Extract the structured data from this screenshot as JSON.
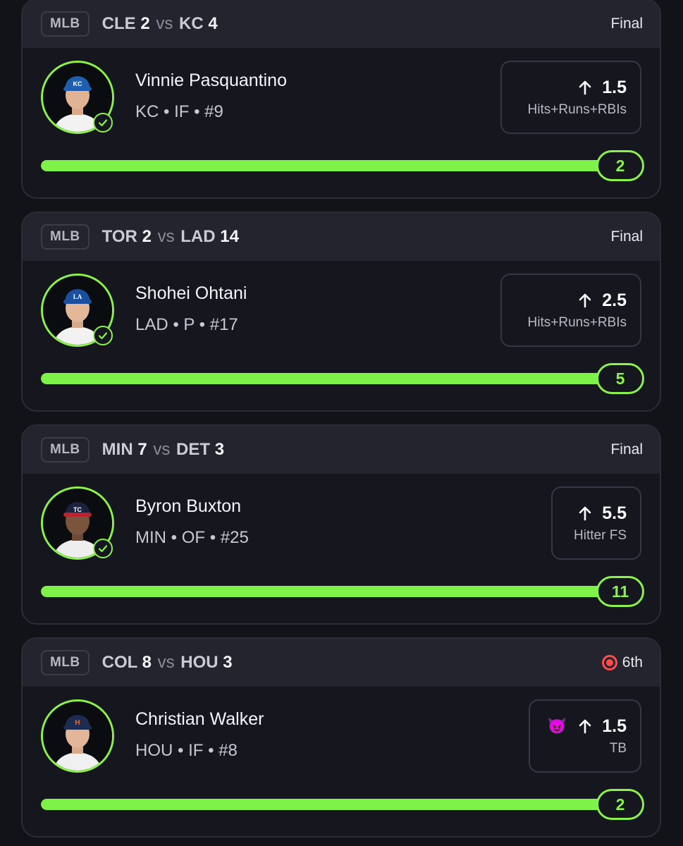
{
  "cards": [
    {
      "league": "MLB",
      "away_team": "CLE",
      "away_score": "2",
      "vs": "vs",
      "home_team": "KC",
      "home_score": "4",
      "status": "Final",
      "player_name": "Vinnie Pasquantino",
      "player_meta": "KC • IF • #9",
      "pick_line": "1.5",
      "pick_stat": "Hits+Runs+RBIs",
      "result": "2",
      "progress": 1.0,
      "cap_color": "#1f5fb0",
      "jersey_color": "#f2f2f2"
    },
    {
      "league": "MLB",
      "away_team": "TOR",
      "away_score": "2",
      "vs": "vs",
      "home_team": "LAD",
      "home_score": "14",
      "status": "Final",
      "player_name": "Shohei Ohtani",
      "player_meta": "LAD • P • #17",
      "pick_line": "2.5",
      "pick_stat": "Hits+Runs+RBIs",
      "result": "5",
      "progress": 1.0,
      "cap_color": "#1a4fa0",
      "jersey_color": "#f2f2f2"
    },
    {
      "league": "MLB",
      "away_team": "MIN",
      "away_score": "7",
      "vs": "vs",
      "home_team": "DET",
      "home_score": "3",
      "status": "Final",
      "player_name": "Byron Buxton",
      "player_meta": "MIN • OF • #25",
      "pick_line": "5.5",
      "pick_stat": "Hitter FS",
      "result": "11",
      "progress": 1.0,
      "cap_color": "#1a2240",
      "jersey_color": "#eeeeee"
    },
    {
      "league": "MLB",
      "away_team": "COL",
      "away_score": "8",
      "vs": "vs",
      "home_team": "HOU",
      "home_score": "3",
      "status": "6th",
      "player_name": "Christian Walker",
      "player_meta": "HOU • IF • #8",
      "pick_line": "1.5",
      "pick_stat": "TB",
      "pick_emoji": "😈",
      "result": "2",
      "progress": 1.0,
      "cap_color": "#1d2d52",
      "jersey_color": "#f0f0f0"
    }
  ],
  "colors": {
    "accent_green": "#8af24a",
    "live_red": "#ff4b4b"
  },
  "icons": {
    "up_arrow": "arrow-up-icon",
    "check": "check-circle-icon",
    "live": "live-record-icon"
  }
}
